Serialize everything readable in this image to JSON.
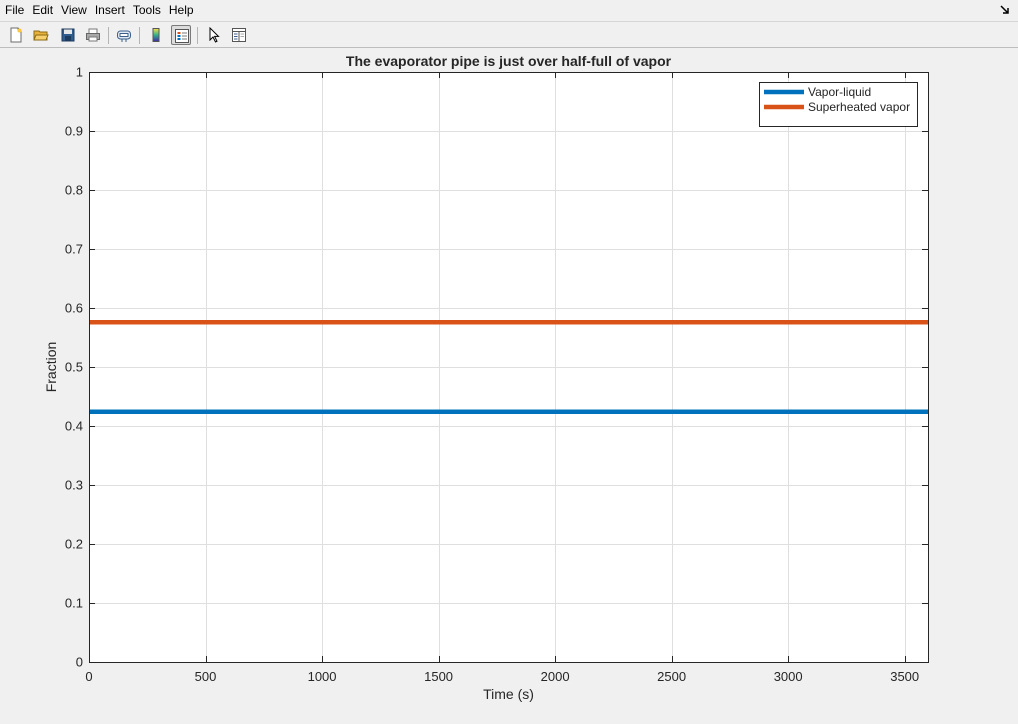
{
  "menu": {
    "items": [
      "File",
      "Edit",
      "View",
      "Insert",
      "Tools",
      "Help"
    ]
  },
  "toolbar": {
    "buttons": [
      {
        "name": "new-figure",
        "icon": "new-file-icon"
      },
      {
        "name": "open-file",
        "icon": "folder-open-icon"
      },
      {
        "name": "save-figure",
        "icon": "save-icon"
      },
      {
        "name": "print-figure",
        "icon": "printer-icon"
      },
      {
        "name": "link-plot",
        "icon": "link-plot-icon"
      },
      {
        "name": "insert-colorbar",
        "icon": "colorbar-icon"
      },
      {
        "name": "insert-legend",
        "icon": "legend-icon",
        "pressed": true
      },
      {
        "name": "edit-plot",
        "icon": "cursor-arrow-icon"
      },
      {
        "name": "property-inspector",
        "icon": "property-inspector-icon"
      }
    ]
  },
  "chart_data": {
    "type": "line",
    "title": "The evaporator pipe is just over half-full of vapor",
    "xlabel": "Time (s)",
    "ylabel": "Fraction",
    "xlim": [
      0,
      3600
    ],
    "ylim": [
      0,
      1
    ],
    "xticks": [
      0,
      500,
      1000,
      1500,
      2000,
      2500,
      3000,
      3500
    ],
    "yticks": [
      0,
      0.1,
      0.2,
      0.3,
      0.4,
      0.5,
      0.6,
      0.7,
      0.8,
      0.9,
      1
    ],
    "grid": true,
    "legend_position": "top-right",
    "series": [
      {
        "name": "Vapor-liquid",
        "color": "#0072bd",
        "x": [
          0,
          3600
        ],
        "y": [
          0.424,
          0.424
        ]
      },
      {
        "name": "Superheated vapor",
        "color": "#d95319",
        "x": [
          0,
          3600
        ],
        "y": [
          0.576,
          0.576
        ]
      }
    ]
  }
}
